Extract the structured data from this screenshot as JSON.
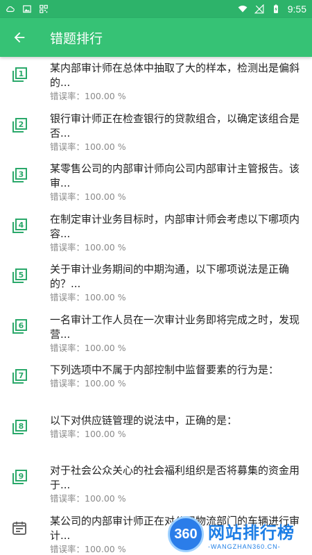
{
  "status_bar": {
    "time": "9:55"
  },
  "app_bar": {
    "title": "错题排行"
  },
  "colors": {
    "primary": "#36c275",
    "status_bar": "#2db36a",
    "icon_green": "#2aa86a",
    "text_gray": "#8a8a8a"
  },
  "list": {
    "items": [
      {
        "index": "1",
        "title": "某内部审计师在总体中抽取了大的样本，检测出是偏斜的...",
        "rate": "错误率：100.00 %"
      },
      {
        "index": "2",
        "title": "银行审计师正在检查银行的贷款组合，以确定该组合是否...",
        "rate": "错误率：100.00 %"
      },
      {
        "index": "3",
        "title": "某零售公司的内部审计师向公司内部审计主管报告。该审...",
        "rate": "错误率：100.00 %"
      },
      {
        "index": "4",
        "title": "在制定审计业务目标时，内部审计师会考虑以下哪项内容...",
        "rate": "错误率：100.00 %"
      },
      {
        "index": "5",
        "title": "关于审计业务期间的中期沟通，以下哪项说法是正确的？...",
        "rate": "错误率：100.00 %"
      },
      {
        "index": "6",
        "title": "一名审计工作人员在一次审计业务即将完成之时，发现营...",
        "rate": "错误率：100.00 %"
      },
      {
        "index": "7",
        "title": "下列选项中不属于内部控制中监督要素的行为是：",
        "rate": "错误率：100.00 %"
      },
      {
        "index": "8",
        "title": "以下对供应链管理的说法中，正确的是：",
        "rate": "错误率：100.00 %"
      },
      {
        "index": "9",
        "title": "对于社会公众关心的社会福利组织是否将募集的资金用于...",
        "rate": "错误率：100.00 %"
      },
      {
        "index": "",
        "title": "某公司的内部审计师正在对公司物流部门的车辆进行审计...",
        "rate": "错误率：100.00 %"
      }
    ]
  },
  "watermark": {
    "badge": "360",
    "main": "网站排行榜",
    "sub": "-WANGZHAN360.CN-"
  }
}
